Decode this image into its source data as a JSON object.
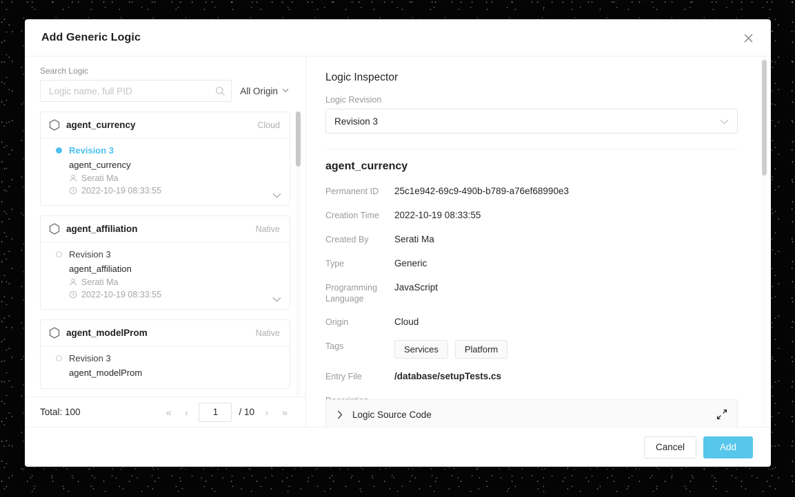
{
  "dialog": {
    "title": "Add Generic Logic",
    "close_icon": "close-icon"
  },
  "search": {
    "label": "Search Logic",
    "placeholder": "Logic name, full PID",
    "value": "",
    "icon": "search-icon",
    "origin_filter": "All Origin",
    "origin_caret": "⌄"
  },
  "list": {
    "cards": [
      {
        "name": "agent_currency",
        "origin": "Cloud",
        "revision": "Revision 3",
        "revision_active": true,
        "sub_name": "agent_currency",
        "author": "Serati Ma",
        "timestamp": "2022-10-19 08:33:55"
      },
      {
        "name": "agent_affiliation",
        "origin": "Native",
        "revision": "Revision 3",
        "revision_active": false,
        "sub_name": "agent_affiliation",
        "author": "Serati Ma",
        "timestamp": "2022-10-19 08:33:55"
      },
      {
        "name": "agent_modelProm",
        "origin": "Native",
        "revision": "Revision 3",
        "revision_active": false,
        "sub_name": "agent_modelProm",
        "author": "",
        "timestamp": ""
      }
    ]
  },
  "pagination": {
    "total_label": "Total: 100",
    "first": "«",
    "prev": "‹",
    "current_page": "1",
    "separator": "/ 10",
    "next": "›",
    "last": "»"
  },
  "inspector": {
    "title": "Logic Inspector",
    "revision_field_label": "Logic Revision",
    "revision_value": "Revision 3",
    "detail_name": "agent_currency",
    "fields": [
      {
        "key": "Permanent ID",
        "value": "25c1e942-69c9-490b-b789-a76ef68990e3",
        "bold": false
      },
      {
        "key": "Creation Time",
        "value": "2022-10-19 08:33:55",
        "bold": false
      },
      {
        "key": "Created By",
        "value": "Serati Ma",
        "bold": false
      },
      {
        "key": "Type",
        "value": "Generic",
        "bold": false
      },
      {
        "key": "Programming Language",
        "value": "JavaScript",
        "bold": false
      },
      {
        "key": "Origin",
        "value": "Cloud",
        "bold": false
      }
    ],
    "tags_label": "Tags",
    "tags": [
      "Services",
      "Platform"
    ],
    "entry_file_label": "Entry File",
    "entry_file_value": "/database/setupTests.cs",
    "description_label": "Description",
    "description_value": "--",
    "source_code_title": "Logic Source Code",
    "source_code_chevron": "›"
  },
  "footer": {
    "cancel_label": "Cancel",
    "add_label": "Add"
  },
  "colors": {
    "accent": "#4cc2ee",
    "add_button": "#56c6ea",
    "text_primary": "#262626",
    "text_muted": "#9a9a9a"
  }
}
